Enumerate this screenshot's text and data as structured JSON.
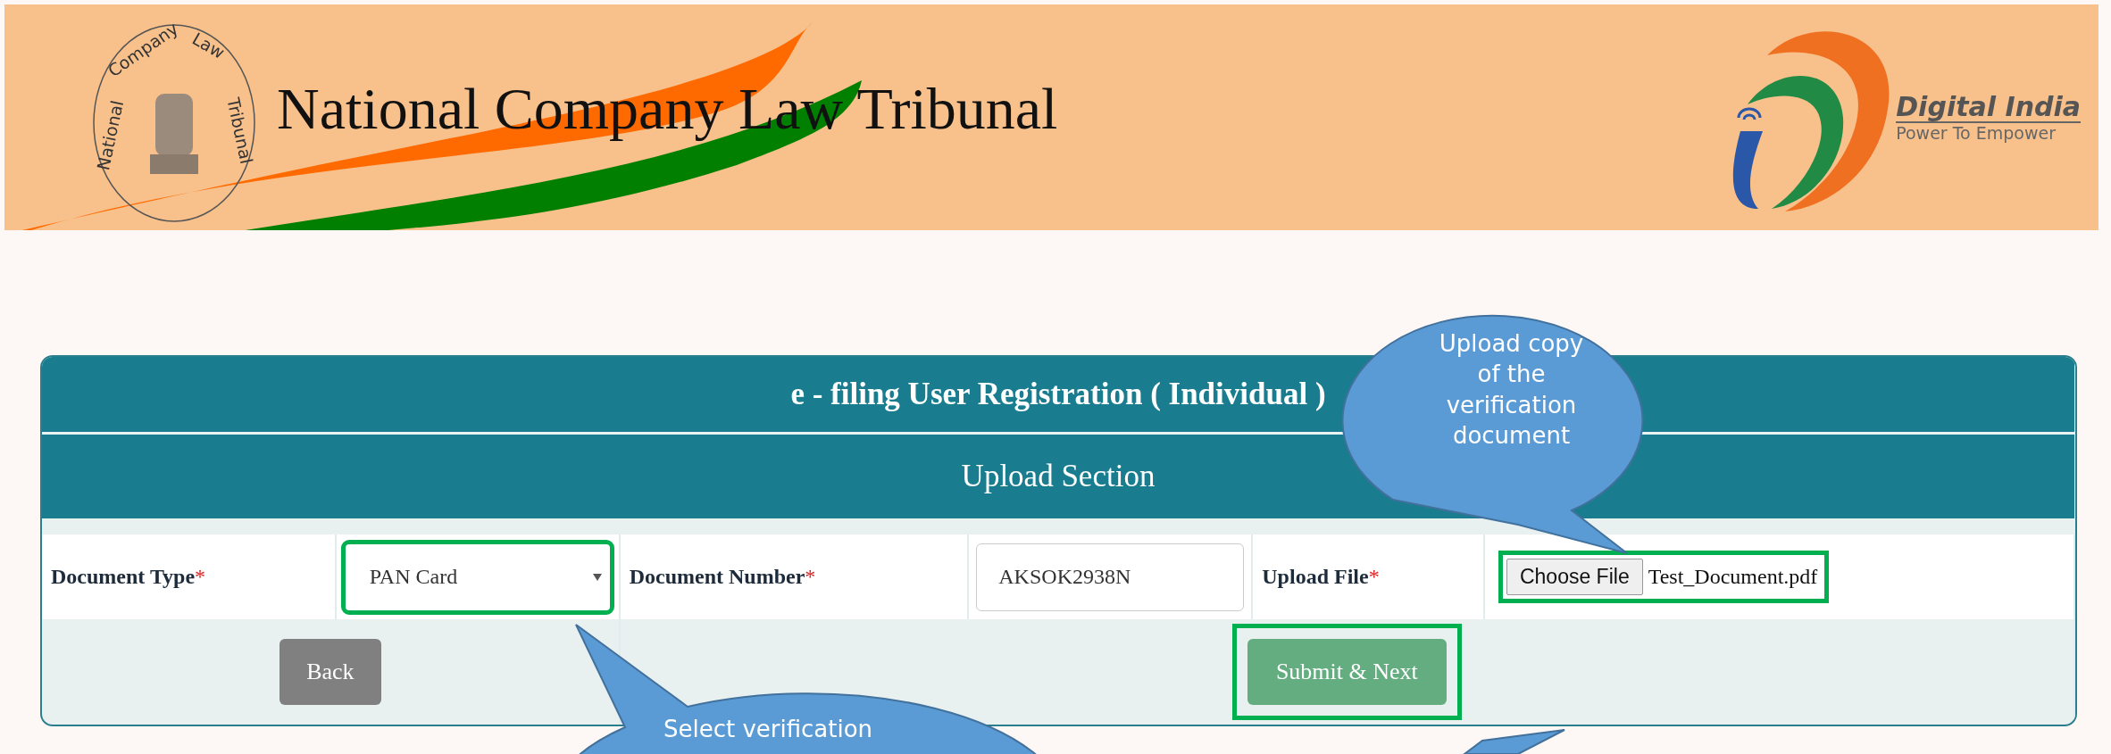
{
  "header": {
    "title": "National Company Law Tribunal",
    "seal_words": [
      "National",
      "Company",
      "Law",
      "Tribunal"
    ],
    "logo": {
      "name": "Digital India",
      "tagline": "Power To Empower"
    }
  },
  "form": {
    "title": "e - filing User Registration ( Individual )",
    "section": "Upload Section",
    "fields": [
      {
        "kind": "select",
        "label": "Document Type",
        "required_mark": "*",
        "value": "PAN Card",
        "highlighted": true
      },
      {
        "kind": "text",
        "label": "Document Number",
        "required_mark": "*",
        "value": "AKSOK2938N",
        "highlighted": false
      },
      {
        "kind": "file",
        "label": "Upload File",
        "required_mark": "*",
        "button": "Choose File",
        "value": "Test_Document.pdf",
        "highlighted": true
      }
    ],
    "buttons": [
      {
        "kind": "back",
        "label": "Back",
        "highlighted": false
      },
      {
        "kind": "submit",
        "label": "Submit & Next",
        "highlighted": true
      }
    ]
  },
  "callouts": [
    {
      "kind": "upload",
      "text": "Upload copy of the verification document"
    },
    {
      "kind": "select",
      "text": "Select verification"
    },
    {
      "kind": "submit"
    }
  ]
}
